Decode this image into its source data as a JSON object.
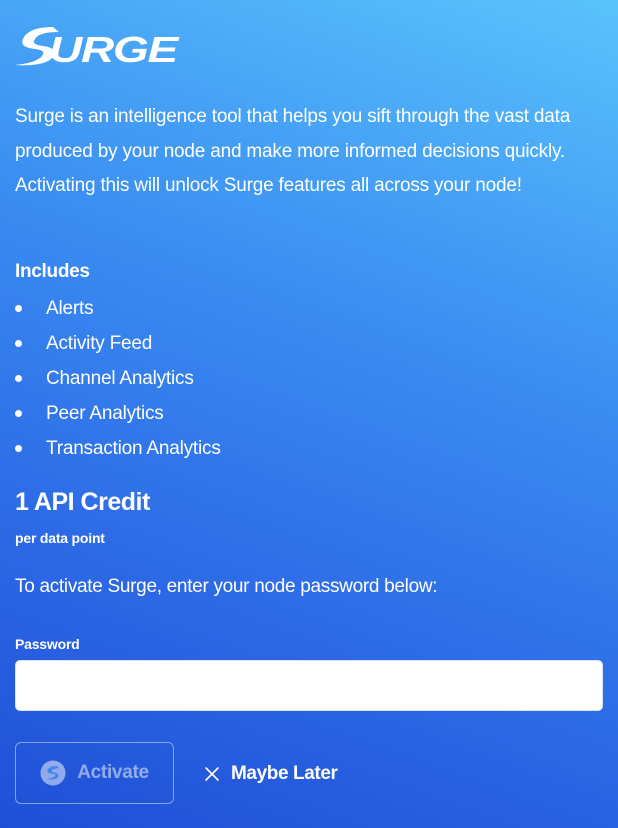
{
  "brand": {
    "logo_text": "SURGE",
    "logo_icon": "surge-logo"
  },
  "description": "Surge is an intelligence tool that helps you sift through the vast data produced by your node and make more informed decisions quickly. Activating this will unlock Surge features all across your node!",
  "includes": {
    "heading": "Includes",
    "items": [
      "Alerts",
      "Activity Feed",
      "Channel Analytics",
      "Peer Analytics",
      "Transaction Analytics"
    ]
  },
  "pricing": {
    "amount": "1 API Credit",
    "unit": "per data point"
  },
  "activation": {
    "instruction": "To activate Surge, enter your node password below:",
    "password_label": "Password",
    "password_value": "",
    "activate_label": "Activate",
    "activate_icon": "surge-bolt-icon",
    "activate_enabled": false,
    "later_label": "Maybe Later",
    "later_icon": "close-icon"
  },
  "colors": {
    "background_top": "#5ac3fb",
    "background_bottom": "#1f4fd6",
    "text": "#ffffff",
    "input_background": "#ffffff"
  }
}
